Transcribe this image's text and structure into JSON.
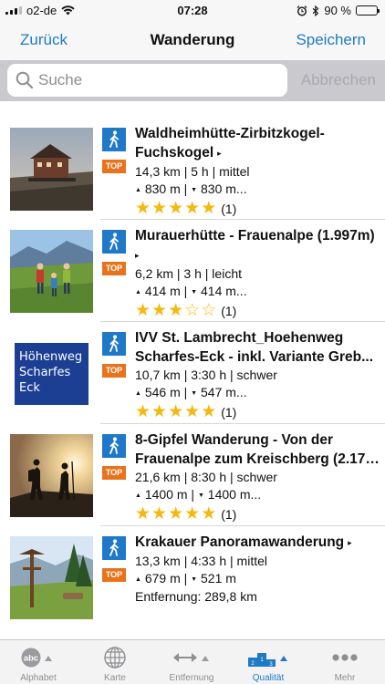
{
  "status_bar": {
    "carrier": "o2-de",
    "time": "07:28",
    "battery_text": "90 %",
    "battery_level": 0.9
  },
  "nav": {
    "back_label": "Zurück",
    "title": "Wanderung",
    "save_label": "Speichern"
  },
  "search": {
    "placeholder": "Suche",
    "value": "",
    "cancel_label": "Abbrechen"
  },
  "badge_text": "TOP",
  "routes": [
    {
      "title": "Waldheimhütte-Zirbitzkogel-Fuchskogel",
      "title_line1": "Waldheimhütte-Zirbitzkogel-",
      "title_line2": "Fuchskogel",
      "stats": "14,3 km | 5 h | mittel",
      "ascent": "830 m",
      "descent": "830 m...",
      "rating": 5,
      "rating_count": "(1)",
      "thumbnail": "hut-photo"
    },
    {
      "title": "Murauerhütte - Frauenalpe (1.997m)",
      "title_line1": "Murauerhütte - Frauenalpe (1.997m)",
      "title_line2": "",
      "stats": "6,2 km | 3 h | leicht",
      "ascent": "414 m",
      "descent": "414 m...",
      "rating": 3,
      "rating_count": "(1)",
      "thumbnail": "family-hikers-photo"
    },
    {
      "title": "IVV St. Lambrecht_Hoehenweg Scharfes-Eck - inkl. Variante Greb...",
      "title_line1": "IVV St. Lambrecht_Hoehenweg",
      "title_line2": "Scharfes-Eck - inkl. Variante Greb...",
      "stats": "10,7 km | 3:30 h | schwer",
      "ascent": "546 m",
      "descent": "547 m...",
      "rating": 5,
      "rating_count": "(1)",
      "thumbnail": "hoehenweg-sign",
      "sign_lines": [
        "Höhenweg",
        "Scharfes",
        "Eck"
      ]
    },
    {
      "title": "8-Gipfel Wanderung - Von der Frauenalpe zum Kreischberg (2.171...",
      "title_line1": "8-Gipfel Wanderung - Von der",
      "title_line2": "Frauenalpe zum Kreischberg (2.171...",
      "stats": "21,6 km | 8:30 h | schwer",
      "ascent": "1400 m",
      "descent": "1400 m...",
      "rating": 5,
      "rating_count": "(1)",
      "thumbnail": "silhouette-hikers-photo"
    },
    {
      "title": "Krakauer Panoramawanderung",
      "title_line1": "Krakauer Panoramawanderung",
      "title_line2": "",
      "stats": "13,3 km | 4:33 h | mittel",
      "ascent": "679 m",
      "descent": "521 m",
      "distance": "Entfernung: 289,8 km",
      "thumbnail": "wayside-cross-photo"
    }
  ],
  "tabs": [
    {
      "label": "Alphabet",
      "icon": "abc-sort-icon",
      "active": false
    },
    {
      "label": "Karte",
      "icon": "globe-icon",
      "active": false
    },
    {
      "label": "Entfernung",
      "icon": "distance-arrows-icon",
      "active": false
    },
    {
      "label": "Qualität",
      "icon": "podium-icon",
      "active": true
    },
    {
      "label": "Mehr",
      "icon": "more-dots-icon",
      "active": false
    }
  ],
  "colors": {
    "accent": "#1f7ac7",
    "top_badge": "#e8731c",
    "hike_icon": "#2078c8",
    "stars": "#f5b80f",
    "search_bar_bg": "#c9c9ce"
  }
}
